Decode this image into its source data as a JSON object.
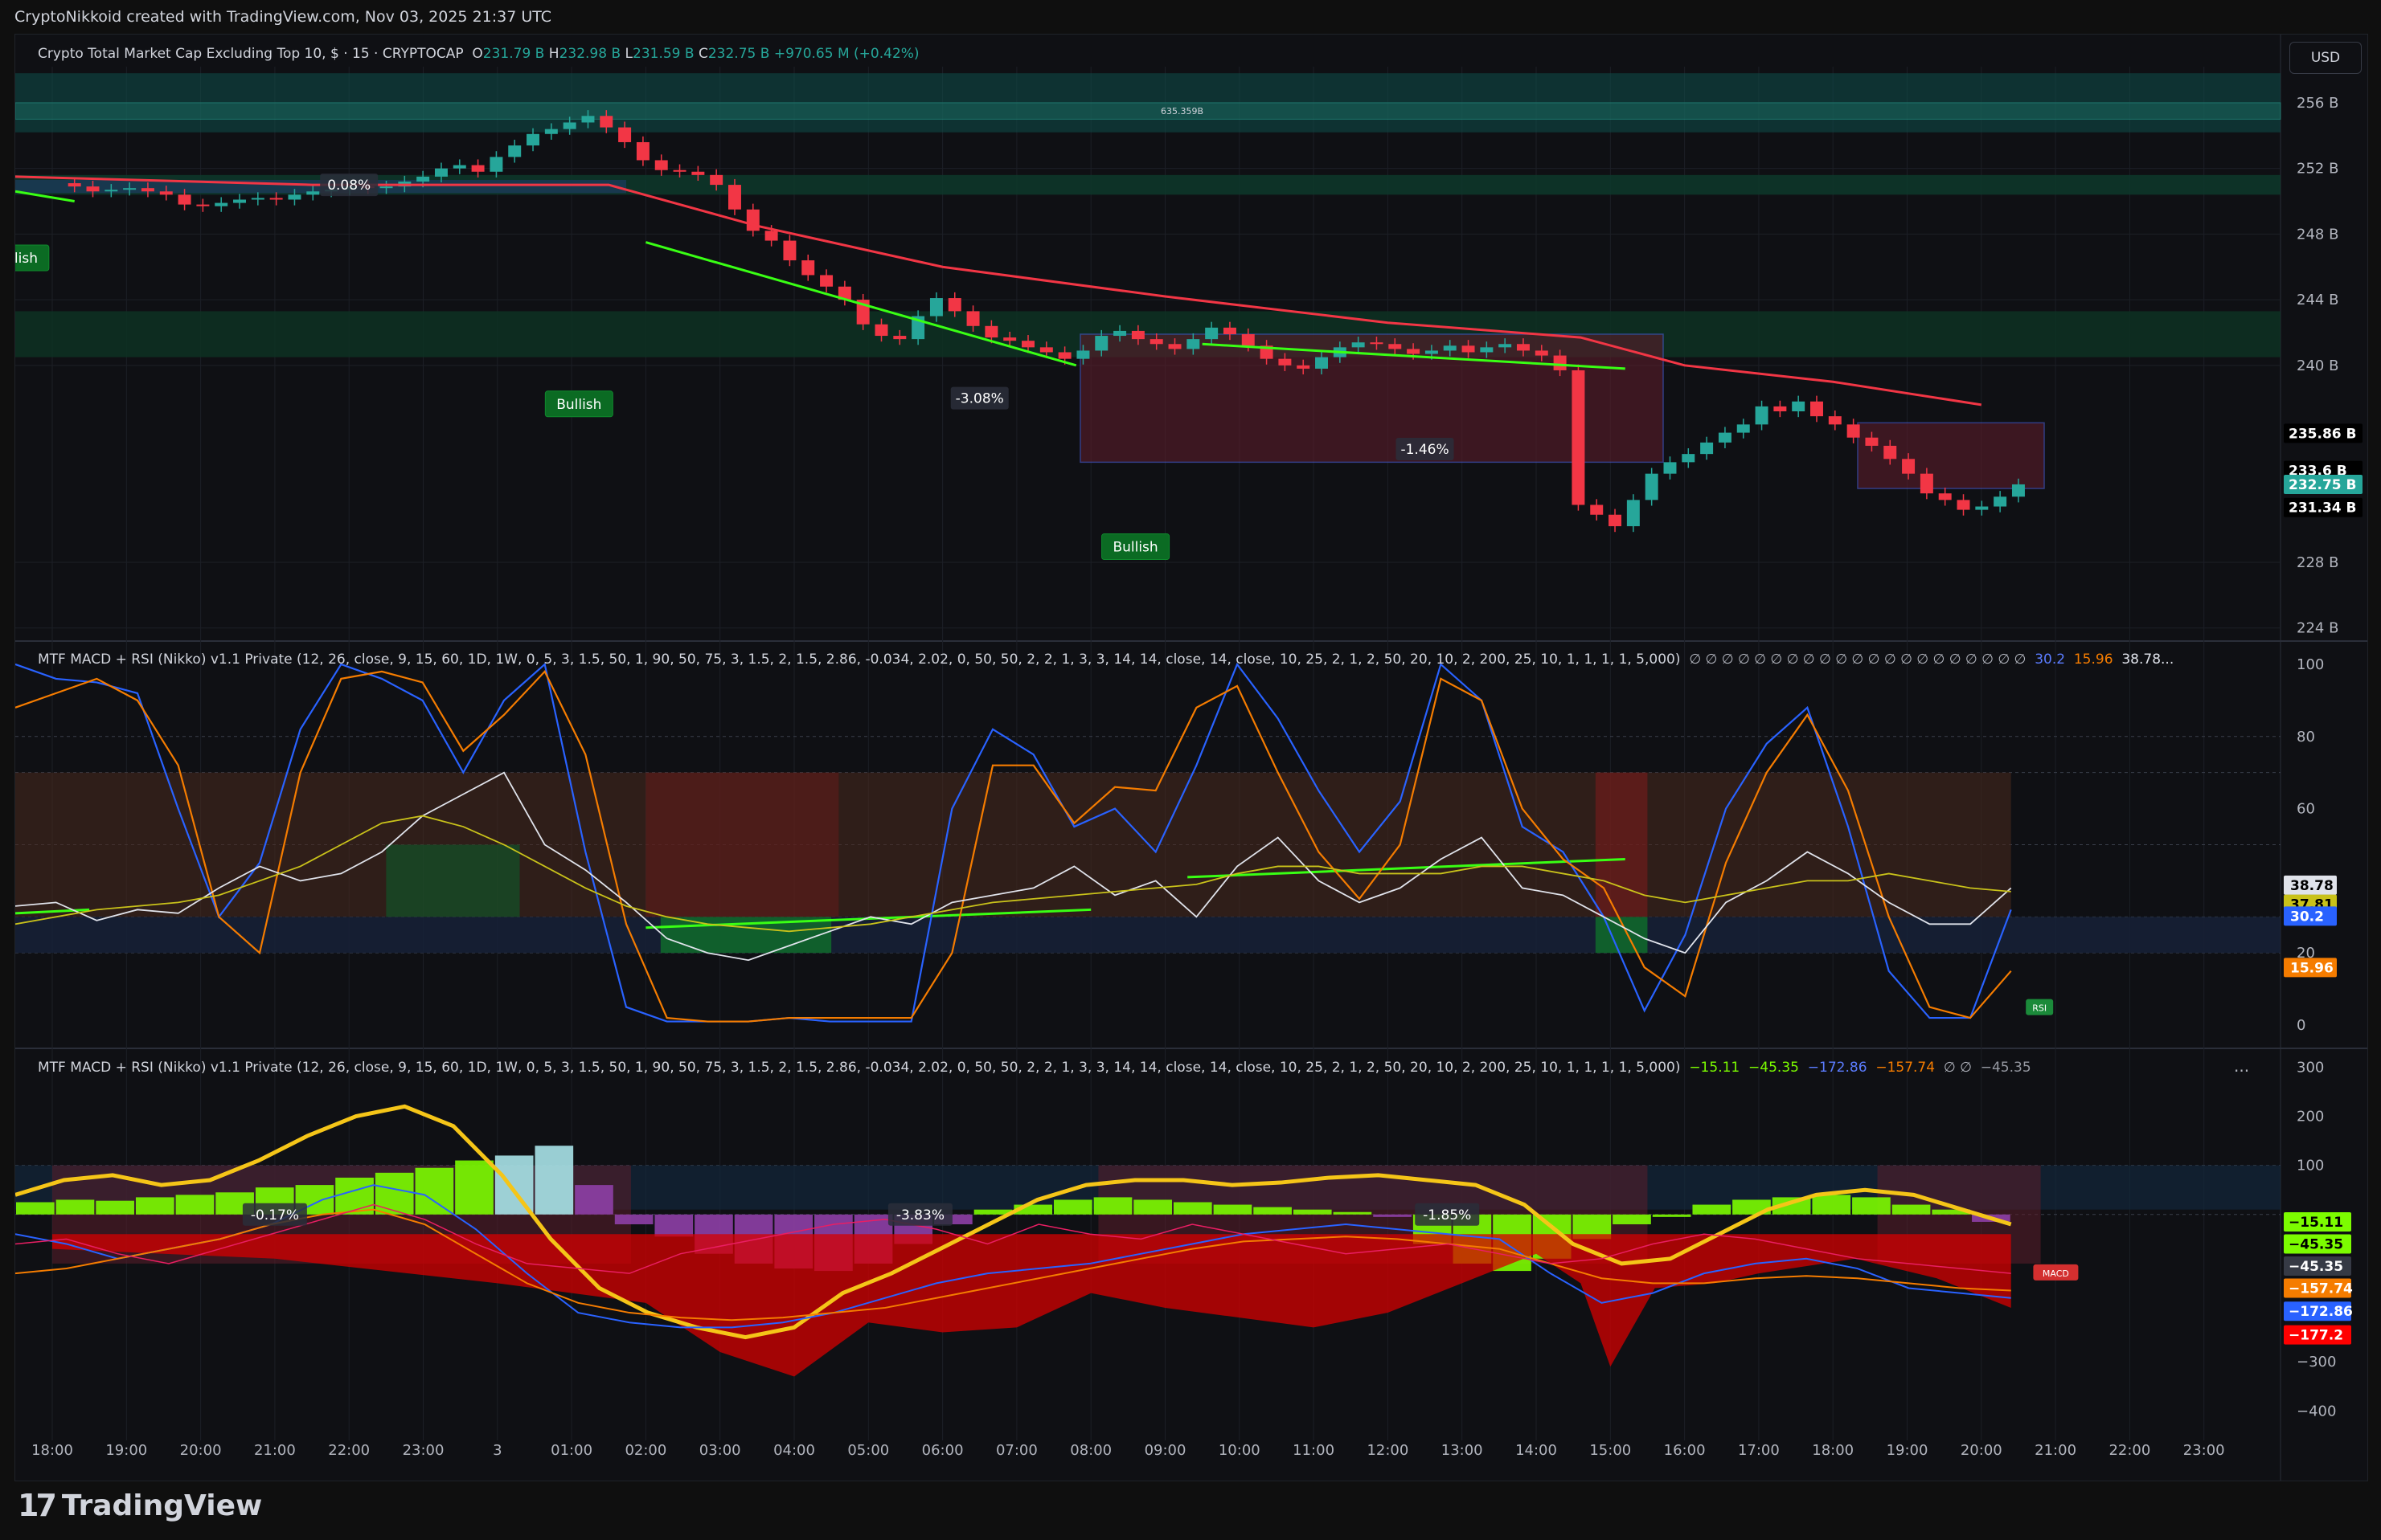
{
  "header": {
    "text": "CryptoNikkoid created with TradingView.com, Nov 03, 2025 21:37 UTC"
  },
  "main_pane": {
    "symbol": "Crypto Total Market Cap Excluding Top 10, $ · 15 · CRYPTOCAP",
    "open_label": "O",
    "open": "231.79 B",
    "high_label": "H",
    "high": "232.98 B",
    "low_label": "L",
    "low": "231.59 B",
    "close_label": "C",
    "close": "232.75 B",
    "change": "+970.65 M (+0.42%)",
    "currency": "USD",
    "zone_label": "635.359B",
    "price_tags": [
      {
        "text": "235.86 B",
        "value": 235.86,
        "bg": "#000000",
        "fg": "#ffffff"
      },
      {
        "text": "233.6 B",
        "value": 233.6,
        "bg": "#000000",
        "fg": "#ffffff"
      },
      {
        "text": "232.75 B",
        "value": 232.75,
        "bg": "#26a69a",
        "fg": "#ffffff"
      },
      {
        "text": "231.34 B",
        "value": 231.34,
        "bg": "#000000",
        "fg": "#ffffff"
      }
    ],
    "annotations": [
      {
        "text": "0.08%",
        "kind": "box",
        "t": 4.0,
        "v": 251.0
      },
      {
        "text": "-3.08%",
        "kind": "box",
        "t": 12.5,
        "v": 238.0
      },
      {
        "text": "-1.46%",
        "kind": "box",
        "t": 18.5,
        "v": 234.9
      },
      {
        "text": "Bullish",
        "kind": "tag",
        "t": -0.5,
        "v": 246.6
      },
      {
        "text": "Bullish",
        "kind": "tag",
        "t": 7.1,
        "v": 237.7
      },
      {
        "text": "Bullish",
        "kind": "tag",
        "t": 14.6,
        "v": 229.0
      }
    ]
  },
  "rsi_pane": {
    "title": "MTF MACD + RSI (Nikko) v1.1 Private (12, 26, close, 9, 15, 60, 1D, 1W, 0, 5, 3, 1.5, 50, 1, 90, 50, 75, 3, 1.5, 2, 1.5, 2.86, -0.034, 2.02, 0, 50, 50, 2, 2, 1, 3, 3, 14, 14, close, 14, close, 10, 25, 2, 1, 2, 50, 20, 10, 2, 200, 25, 10, 1, 1, 1, 1, 5,000)",
    "null_values": "∅ ∅ ∅ ∅ ∅ ∅ ∅ ∅ ∅ ∅ ∅ ∅ ∅ ∅ ∅ ∅ ∅ ∅ ∅ ∅ ∅",
    "value_a": "30.2",
    "value_b": "15.96",
    "value_c": "38.78...",
    "rsi_label": "RSI",
    "tags": [
      {
        "text": "38.78",
        "value": 38.78,
        "bg": "#e0e3eb",
        "fg": "#000000"
      },
      {
        "text": "37.81",
        "value": 33.5,
        "bg": "#c9c21a",
        "fg": "#000000"
      },
      {
        "text": "30.2",
        "value": 30.2,
        "bg": "#2962ff",
        "fg": "#ffffff"
      },
      {
        "text": "15.96",
        "value": 15.96,
        "bg": "#f57c00",
        "fg": "#ffffff"
      }
    ]
  },
  "macd_pane": {
    "title": "MTF MACD + RSI (Nikko) v1.1 Private (12, 26, close, 9, 15, 60, 1D, 1W, 0, 5, 3, 1.5, 50, 1, 90, 50, 75, 3, 1.5, 2, 1.5, 2.86, -0.034, 2.02, 0, 50, 50, 2, 2, 1, 3, 3, 14, 14, close, 14, close, 10, 25, 2, 1, 2, 50, 20, 10, 2, 200, 25, 10, 1, 1, 1, 1, 5,000)",
    "values": [
      {
        "text": "−15.11",
        "color": "#7cfc00"
      },
      {
        "text": "−45.35",
        "color": "#7cfc00"
      },
      {
        "text": "−172.86",
        "color": "#5b7cff"
      },
      {
        "text": "−157.74",
        "color": "#f57c00"
      },
      {
        "text": "∅ ∅",
        "color": "#b2b5be"
      },
      {
        "text": "−45.35",
        "color": "#9598a1"
      }
    ],
    "more": "...",
    "macd_label": "MACD",
    "annotations": [
      {
        "text": "-0.17%",
        "t": 3.0
      },
      {
        "text": "-3.83%",
        "t": 11.7
      },
      {
        "text": "-1.85%",
        "t": 18.8
      }
    ],
    "tags": [
      {
        "text": "−15.11",
        "value": -15.11,
        "bg": "#7cfc00",
        "fg": "#000000"
      },
      {
        "text": "−45.35",
        "value": -60,
        "bg": "#7cfc00",
        "fg": "#000000"
      },
      {
        "text": "−45.35",
        "value": -105,
        "bg": "#363a45",
        "fg": "#ffffff"
      },
      {
        "text": "−157.74",
        "value": -150,
        "bg": "#f57c00",
        "fg": "#ffffff"
      },
      {
        "text": "−172.86",
        "value": -197,
        "bg": "#2962ff",
        "fg": "#ffffff"
      },
      {
        "text": "−177.2",
        "value": -245,
        "bg": "#ff0000",
        "fg": "#ffffff"
      }
    ]
  },
  "footer": {
    "brand": "TradingView",
    "mark": "17"
  },
  "colors": {
    "up": "#26a69a",
    "down": "#f23645",
    "ema": "#f23645",
    "trend": "#39ff14",
    "grid": "#1c1f26"
  },
  "chart_data": [
    {
      "type": "candlestick",
      "title": "Crypto Total Market Cap Excluding Top 10, $ · 15 · CRYPTOCAP",
      "x_ticks": [
        "18:00",
        "19:00",
        "20:00",
        "21:00",
        "22:00",
        "23:00",
        "3",
        "01:00",
        "02:00",
        "03:00",
        "04:00",
        "05:00",
        "06:00",
        "07:00",
        "08:00",
        "09:00",
        "10:00",
        "11:00",
        "12:00",
        "13:00",
        "14:00",
        "15:00",
        "16:00",
        "17:00",
        "18:00",
        "19:00",
        "20:00",
        "21:00",
        "22:00",
        "23:00"
      ],
      "y_ticks": [
        "256 B",
        "252 B",
        "248 B",
        "244 B",
        "240 B",
        "228 B",
        "224 B"
      ],
      "ylim": [
        223.3,
        258.2
      ],
      "close_series": [
        250.9,
        250.6,
        250.7,
        250.8,
        250.6,
        250.4,
        249.8,
        249.7,
        249.9,
        250.1,
        250.2,
        250.1,
        250.4,
        250.6,
        250.7,
        250.9,
        250.8,
        250.9,
        251.2,
        251.5,
        252.0,
        252.2,
        251.8,
        252.7,
        253.4,
        254.1,
        254.4,
        254.8,
        255.2,
        254.5,
        253.6,
        252.5,
        251.9,
        251.8,
        251.6,
        251.0,
        249.5,
        248.2,
        247.6,
        246.4,
        245.5,
        244.8,
        244.0,
        242.5,
        241.8,
        241.6,
        243.0,
        244.1,
        243.3,
        242.4,
        241.7,
        241.5,
        241.1,
        240.8,
        240.4,
        240.9,
        241.8,
        242.1,
        241.6,
        241.3,
        241.0,
        241.6,
        242.3,
        241.9,
        241.2,
        240.4,
        240.0,
        239.8,
        240.5,
        241.1,
        241.4,
        241.3,
        241.0,
        240.7,
        240.9,
        241.2,
        240.8,
        241.1,
        241.3,
        240.9,
        240.6,
        239.7,
        231.5,
        230.9,
        230.2,
        231.8,
        233.4,
        234.1,
        234.6,
        235.3,
        235.9,
        236.4,
        237.5,
        237.2,
        237.8,
        236.9,
        236.4,
        235.6,
        235.1,
        234.3,
        233.4,
        232.2,
        231.8,
        231.2,
        231.4,
        232.0,
        232.75
      ],
      "ema": [
        {
          "t": -0.5,
          "v": 251.5
        },
        {
          "t": 3.5,
          "v": 251.0
        },
        {
          "t": 7.5,
          "v": 251.0
        },
        {
          "t": 9.5,
          "v": 248.5
        },
        {
          "t": 12.0,
          "v": 246.0
        },
        {
          "t": 15.0,
          "v": 244.2
        },
        {
          "t": 18.0,
          "v": 242.6
        },
        {
          "t": 20.6,
          "v": 241.7
        },
        {
          "t": 22.0,
          "v": 240.0
        },
        {
          "t": 24.0,
          "v": 239.0
        },
        {
          "t": 26.0,
          "v": 237.6
        }
      ]
    },
    {
      "type": "line",
      "title": "MTF MACD + RSI (Nikko) v1.1 Private",
      "y_ticks": [
        "100",
        "80",
        "60",
        "20",
        "0"
      ],
      "ylim": [
        -6,
        106
      ],
      "series": [
        {
          "color": "#2962ff",
          "values": [
            100,
            96,
            95,
            92,
            60,
            30,
            45,
            82,
            100,
            96,
            90,
            70,
            90,
            100,
            48,
            5,
            1,
            1,
            1,
            2,
            1,
            1,
            1,
            60,
            82,
            75,
            55,
            60,
            48,
            72,
            100,
            85,
            65,
            48,
            62,
            100,
            90,
            55,
            48,
            30,
            4,
            25,
            60,
            78,
            88,
            55,
            15,
            2,
            2,
            32
          ]
        },
        {
          "color": "#f57c00",
          "values": [
            88,
            92,
            96,
            90,
            72,
            30,
            20,
            70,
            96,
            98,
            95,
            76,
            86,
            98,
            75,
            28,
            2,
            1,
            1,
            2,
            2,
            2,
            2,
            20,
            72,
            72,
            56,
            66,
            65,
            88,
            94,
            70,
            48,
            35,
            50,
            96,
            90,
            60,
            46,
            38,
            16,
            8,
            45,
            70,
            86,
            65,
            30,
            5,
            2,
            15
          ]
        },
        {
          "color": "#e0e3eb",
          "values": [
            33,
            34,
            29,
            32,
            31,
            38,
            44,
            40,
            42,
            48,
            58,
            64,
            70,
            50,
            43,
            34,
            24,
            20,
            18,
            22,
            26,
            30,
            28,
            34,
            36,
            38,
            44,
            36,
            40,
            30,
            44,
            52,
            40,
            34,
            38,
            46,
            52,
            38,
            36,
            30,
            24,
            20,
            34,
            40,
            48,
            42,
            34,
            28,
            28,
            38
          ]
        },
        {
          "color": "#c9c21a",
          "values": [
            28,
            30,
            32,
            33,
            34,
            36,
            40,
            44,
            50,
            56,
            58,
            55,
            50,
            44,
            38,
            33,
            30,
            28,
            27,
            26,
            27,
            28,
            30,
            32,
            34,
            35,
            36,
            37,
            38,
            39,
            42,
            44,
            44,
            42,
            42,
            42,
            44,
            44,
            42,
            40,
            36,
            34,
            36,
            38,
            40,
            40,
            42,
            40,
            38,
            37
          ]
        }
      ]
    },
    {
      "type": "bar",
      "title": "MTF MACD + RSI (Nikko) v1.1 Private",
      "y_ticks": [
        "300",
        "200",
        "100",
        "−300",
        "−400"
      ],
      "ylim": [
        -460,
        335
      ],
      "histogram": [
        25,
        30,
        28,
        35,
        40,
        45,
        55,
        60,
        75,
        85,
        95,
        110,
        120,
        140,
        60,
        -20,
        -45,
        -80,
        -100,
        -110,
        -115,
        -100,
        -60,
        -20,
        10,
        20,
        30,
        35,
        30,
        25,
        20,
        15,
        10,
        5,
        -5,
        -60,
        -100,
        -115,
        -90,
        -50,
        -20,
        -5,
        20,
        30,
        35,
        40,
        35,
        20,
        10,
        -15
      ],
      "signal": [
        40,
        70,
        80,
        60,
        70,
        110,
        160,
        200,
        220,
        180,
        80,
        -50,
        -150,
        -200,
        -230,
        -250,
        -230,
        -160,
        -120,
        -70,
        -20,
        30,
        60,
        70,
        70,
        60,
        65,
        75,
        80,
        70,
        60,
        20,
        -60,
        -100,
        -90,
        -40,
        10,
        40,
        50,
        40,
        10,
        -20
      ]
    }
  ]
}
